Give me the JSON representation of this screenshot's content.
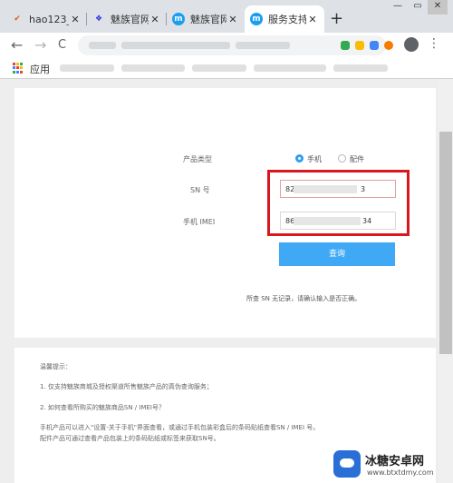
{
  "tabs": [
    {
      "title": "hao123_",
      "favicon": "hao123-icon",
      "active": false
    },
    {
      "title": "魅族官网",
      "favicon": "baidu-paw-icon",
      "active": false
    },
    {
      "title": "魅族官网",
      "favicon": "meizu-icon",
      "active": false
    },
    {
      "title": "服务支持",
      "favicon": "meizu-icon",
      "active": true
    }
  ],
  "new_tab_label": "+",
  "window_controls": {
    "minimize": "—",
    "restore": "▭",
    "close": "✕"
  },
  "toolbar": {
    "back": "←",
    "forward": "→",
    "refresh": "C",
    "menu": "⋮"
  },
  "bookmarks": {
    "apps_label": "应用"
  },
  "form": {
    "product_type_label": "产品类型",
    "option_phone": "手机",
    "option_accessory": "配件",
    "sn_label": "SN 号",
    "sn_value_prefix": "82",
    "sn_value_suffix": "3",
    "imei_label": "手机 IMEI",
    "imei_value_prefix": "86",
    "imei_value_suffix": "34",
    "query_button": "查询",
    "hint": "所查 SN 无记录，请确认输入是否正确。"
  },
  "tips": {
    "heading": "温馨提示：",
    "item1": "1. 仅支持魅族商城及授权渠道所售魅族产品的真伪查询服务；",
    "item2": "2. 如何查看所购买的魅族商品SN / IMEI号？",
    "item3": "手机产品可以进入\"设置-关于手机\"界面查看，或通过手机包装彩盒后的条码贴纸查看SN / IMEI 号。",
    "item4": "配件产品可通过查看产品包装上的条码贴纸或标签来获取SN号。"
  },
  "watermark": {
    "title": "冰糖安卓网",
    "url": "www.btxtdmy.com"
  },
  "colors": {
    "accent": "#3fa9f5",
    "highlight": "#d9171e"
  }
}
